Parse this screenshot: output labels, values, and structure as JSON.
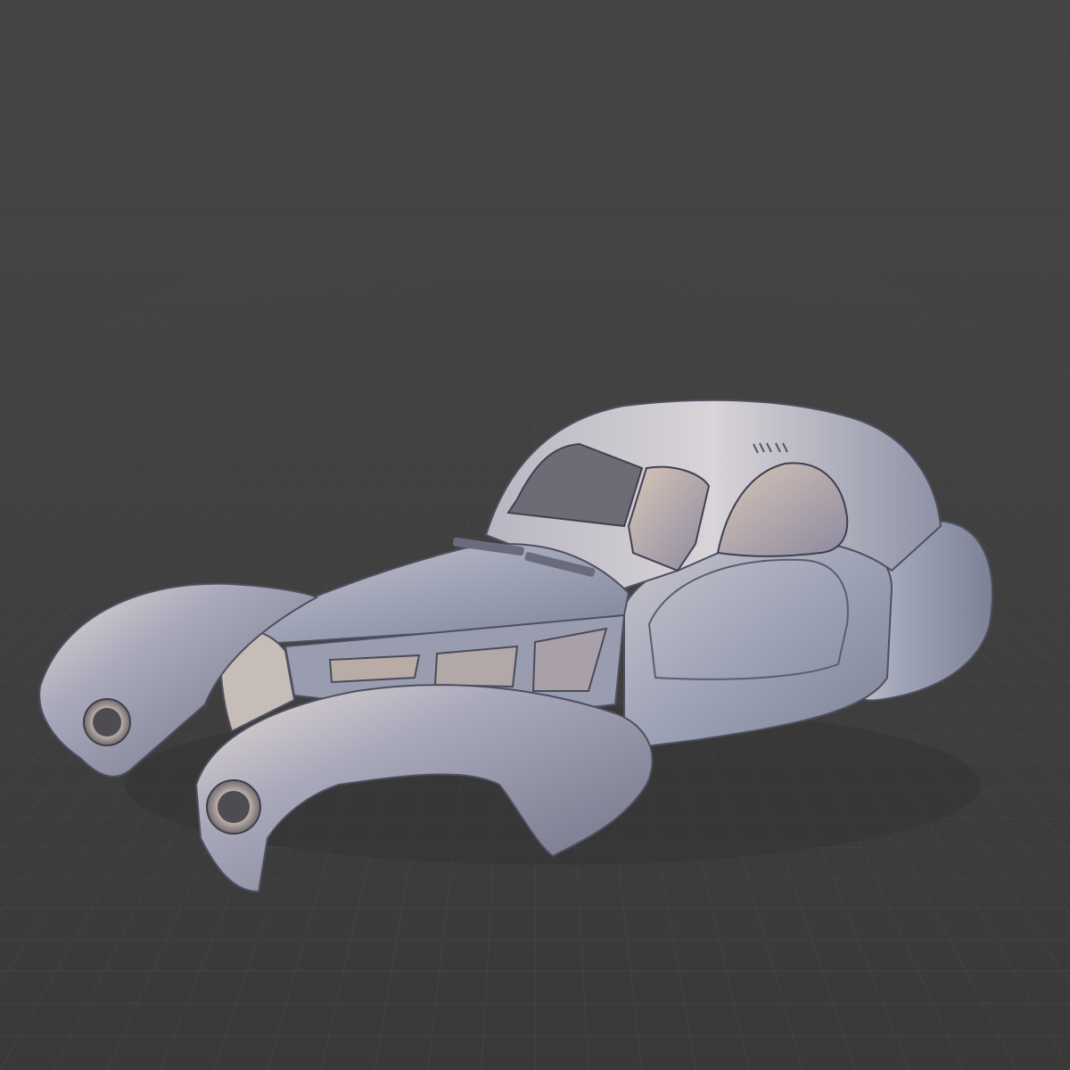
{
  "scene": {
    "background_top": "#444444",
    "background_bottom": "#3a3a3a",
    "grid_line_color": "#4a4a4a",
    "grid_line_color_dark": "#333333",
    "model_color": "#a2a6b8",
    "model_highlight": "#e2e0e4",
    "model_shadow": "#5a5d6a",
    "model_warm": "#c9b6a5"
  }
}
